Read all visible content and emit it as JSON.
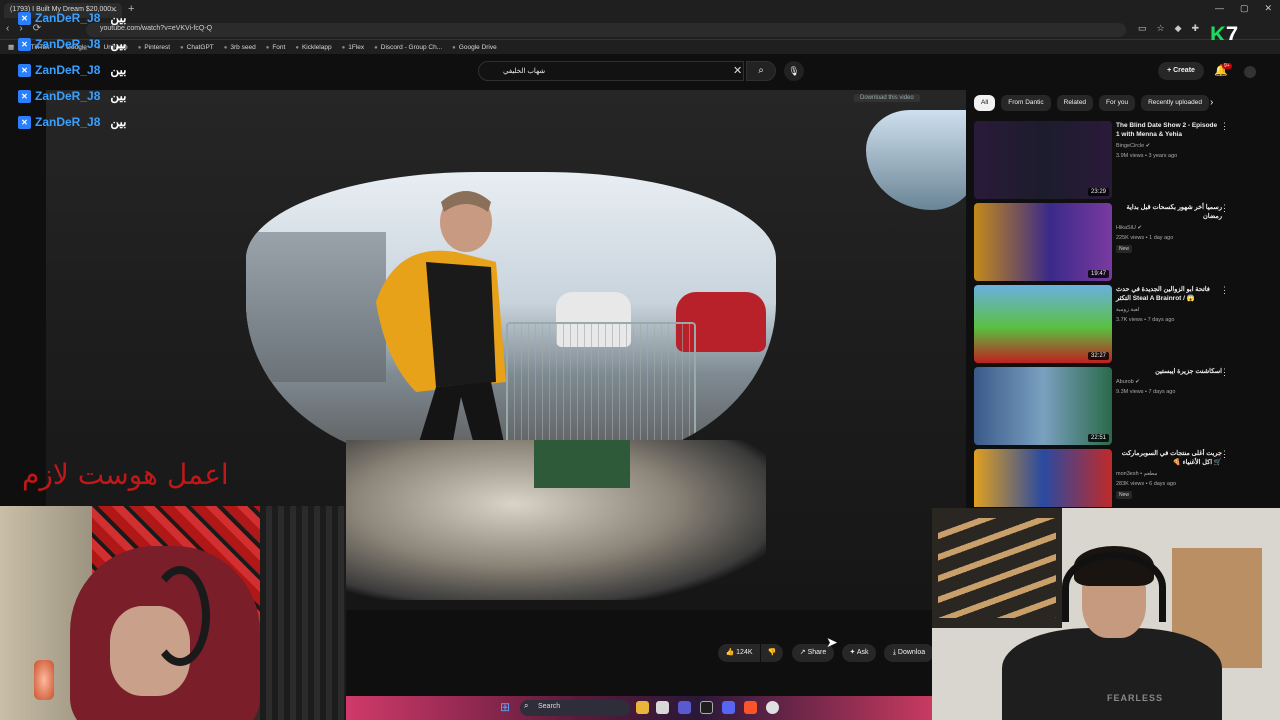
{
  "browser": {
    "tab_title": "(1793) I Built My Dream $20,000...",
    "tab_close": "✕",
    "new_tab": "+",
    "window_controls": [
      "—",
      "▢",
      "✕"
    ],
    "url": "youtube.com/watch?v=eVKVi-fcQ-Q",
    "nav": [
      "‹",
      "›",
      "⟳"
    ],
    "bookmarks": [
      "TikTok",
      "Google",
      "Uniregle",
      "Pinterest",
      "ChatGPT",
      "3rb seed",
      "Font",
      "Kicklelapp",
      "1Flex",
      "Discord - Group Ch...",
      "Google Drive"
    ]
  },
  "youtube": {
    "search_value": "شهاب الخليفي",
    "create_label": "Create",
    "notification_count": "9+"
  },
  "chat_overlay": [
    {
      "user": "ZanDeR_J8",
      "message": "بين"
    },
    {
      "user": "ZanDeR_J8",
      "message": "بين"
    },
    {
      "user": "ZanDeR_J8",
      "message": "بين"
    },
    {
      "user": "ZanDeR_J8",
      "message": "بين"
    },
    {
      "user": "ZanDeR_J8",
      "message": "بين"
    }
  ],
  "video": {
    "download_hint": "Download this video",
    "overlay_text": "اعمل هوست لازم"
  },
  "actions": {
    "like_count": "124K",
    "share": "Share",
    "ask": "Ask",
    "download": "Downloa"
  },
  "taskbar": {
    "search_placeholder": "Search"
  },
  "chips": [
    "All",
    "From Dantic",
    "Related",
    "For you",
    "Recently uploaded"
  ],
  "recommendations": [
    {
      "title": "The Blind Date Show 2 - Episode 1 with Menna & Yehia",
      "channel": "BingeCircle ✔",
      "meta": "3.9M views • 3 years ago",
      "duration": "23:29",
      "new": ""
    },
    {
      "title": "رسميا أخر شهور بكسحات قبل بداية رمضان",
      "channel": "HikaSiU ✔",
      "meta": "225K views • 1 day ago",
      "duration": "19:47",
      "new": "New"
    },
    {
      "title": "فاتحة ابو الزوالين الجديدة في حدث التكثر Steal A Brainrot / 😱",
      "channel": "لعبة زومبة",
      "meta": "3.7K views • 7 days ago",
      "duration": "32:27",
      "new": ""
    },
    {
      "title": "اسكاشنت جزيرة ايبستين",
      "channel": "Aburob ✔",
      "meta": "9.3M views • 7 days ago",
      "duration": "22:51",
      "new": ""
    },
    {
      "title": "جربت أغلى منتجات في السوبرماركت 🛒 اكل الأغنياء 🍕",
      "channel": "mon3esh • مطعم",
      "meta": "283K views • 6 days ago",
      "duration": "",
      "new": "New"
    }
  ],
  "webcam2_shirt_text": "FEARLESS",
  "logo": {
    "k": "K",
    "n": "7"
  }
}
